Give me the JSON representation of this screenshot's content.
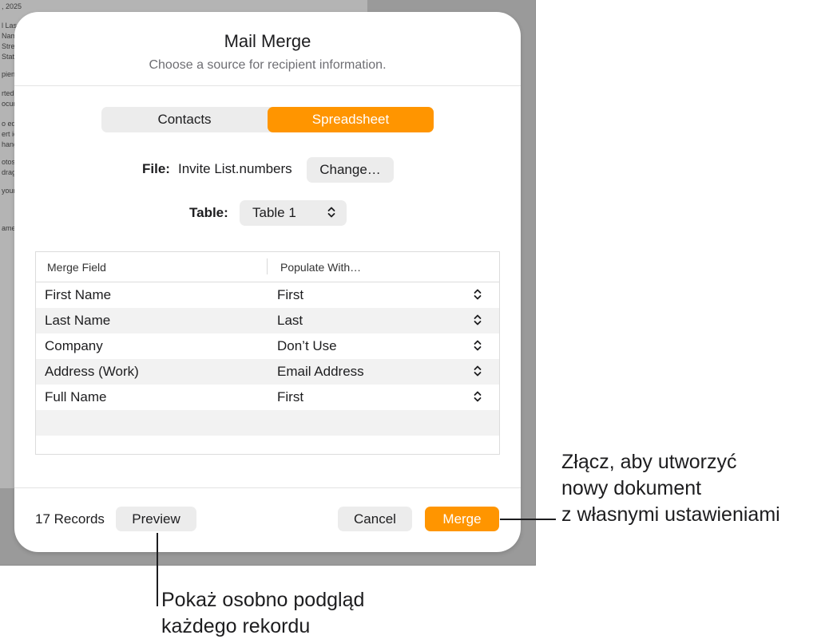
{
  "background": {
    "text_lines": [
      ", 2025",
      "l Las",
      "Nam",
      "Stre",
      "Stat",
      "pien",
      "rted",
      "ocum",
      "o ed",
      "ert ic",
      "hang",
      "otos",
      "drag",
      "your",
      "ame"
    ]
  },
  "dialog": {
    "title": "Mail Merge",
    "subtitle": "Choose a source for recipient information.",
    "source_tabs": [
      {
        "label": "Contacts",
        "selected": false
      },
      {
        "label": "Spreadsheet",
        "selected": true
      }
    ],
    "file": {
      "label": "File:",
      "value": "Invite List.numbers",
      "change_label": "Change…"
    },
    "table_select": {
      "label": "Table:",
      "value": "Table 1"
    },
    "mapping": {
      "headers": [
        "Merge Field",
        "Populate With…"
      ],
      "rows": [
        {
          "field": "First Name",
          "source": "First"
        },
        {
          "field": "Last Name",
          "source": "Last"
        },
        {
          "field": "Company",
          "source": "Don’t Use"
        },
        {
          "field": "Address (Work)",
          "source": "Email Address"
        },
        {
          "field": "Full Name",
          "source": "First"
        }
      ]
    },
    "footer": {
      "records": "17 Records",
      "preview_label": "Preview",
      "cancel_label": "Cancel",
      "merge_label": "Merge"
    }
  },
  "callouts": {
    "merge_lines": [
      "Złącz, aby utworzyć",
      "nowy dokument",
      "z własnymi ustawieniami"
    ],
    "preview_lines": [
      "Pokaż osobno podgląd",
      "każdego rekordu"
    ]
  },
  "colors": {
    "accent": "#ff9500",
    "button_bg": "#ececec",
    "alt_row": "#f2f2f2"
  }
}
